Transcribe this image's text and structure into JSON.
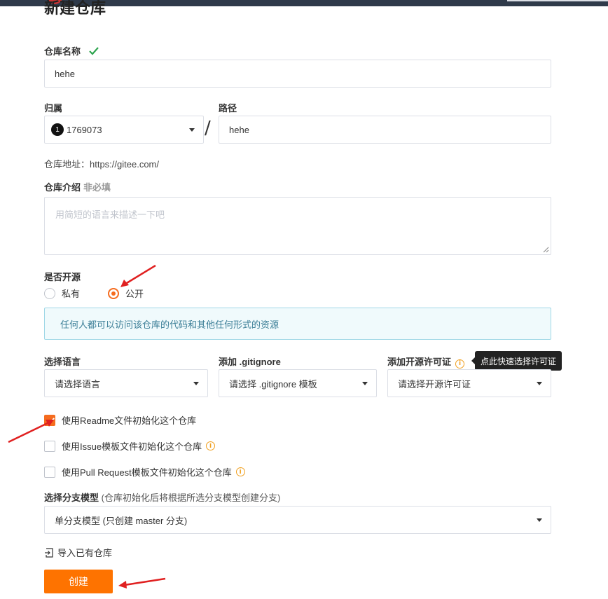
{
  "page": {
    "title": "新建仓库"
  },
  "repo_name": {
    "label": "仓库名称",
    "value": "hehe",
    "valid_icon": "check-icon"
  },
  "owner": {
    "label": "归属",
    "badge": "1",
    "value": "1769073"
  },
  "path": {
    "label": "路径",
    "value": "hehe"
  },
  "repo_address": {
    "text": "仓库地址：https://gitee.com/"
  },
  "description": {
    "label": "仓库介绍",
    "optional": "非必填",
    "placeholder": "用简短的语言来描述一下吧"
  },
  "visibility": {
    "label": "是否开源",
    "options": [
      {
        "label": "私有",
        "checked": false
      },
      {
        "label": "公开",
        "checked": true
      }
    ],
    "info": "任何人都可以访问该仓库的代码和其他任何形式的资源"
  },
  "language": {
    "label": "选择语言",
    "placeholder": "请选择语言"
  },
  "gitignore": {
    "label": "添加 .gitignore",
    "placeholder": "请选择 .gitignore 模板"
  },
  "license": {
    "label": "添加开源许可证",
    "placeholder": "请选择开源许可证",
    "tooltip": "点此快速选择许可证"
  },
  "init_options": [
    {
      "label": "使用Readme文件初始化这个仓库",
      "checked": true,
      "info": false
    },
    {
      "label": "使用Issue模板文件初始化这个仓库",
      "checked": false,
      "info": true
    },
    {
      "label": "使用Pull Request模板文件初始化这个仓库",
      "checked": false,
      "info": true
    }
  ],
  "branch_model": {
    "label": "选择分支模型",
    "hint": "(仓库初始化后将根据所选分支模型创建分支)",
    "value": "单分支模型 (只创建 master 分支)"
  },
  "import_link": {
    "label": "导入已有仓库"
  },
  "create_button": {
    "label": "创建"
  },
  "colors": {
    "accent": "#fe7300",
    "check_green": "#2ea44f",
    "annotation_red": "#e02020",
    "info_border": "#9fd7e6"
  }
}
